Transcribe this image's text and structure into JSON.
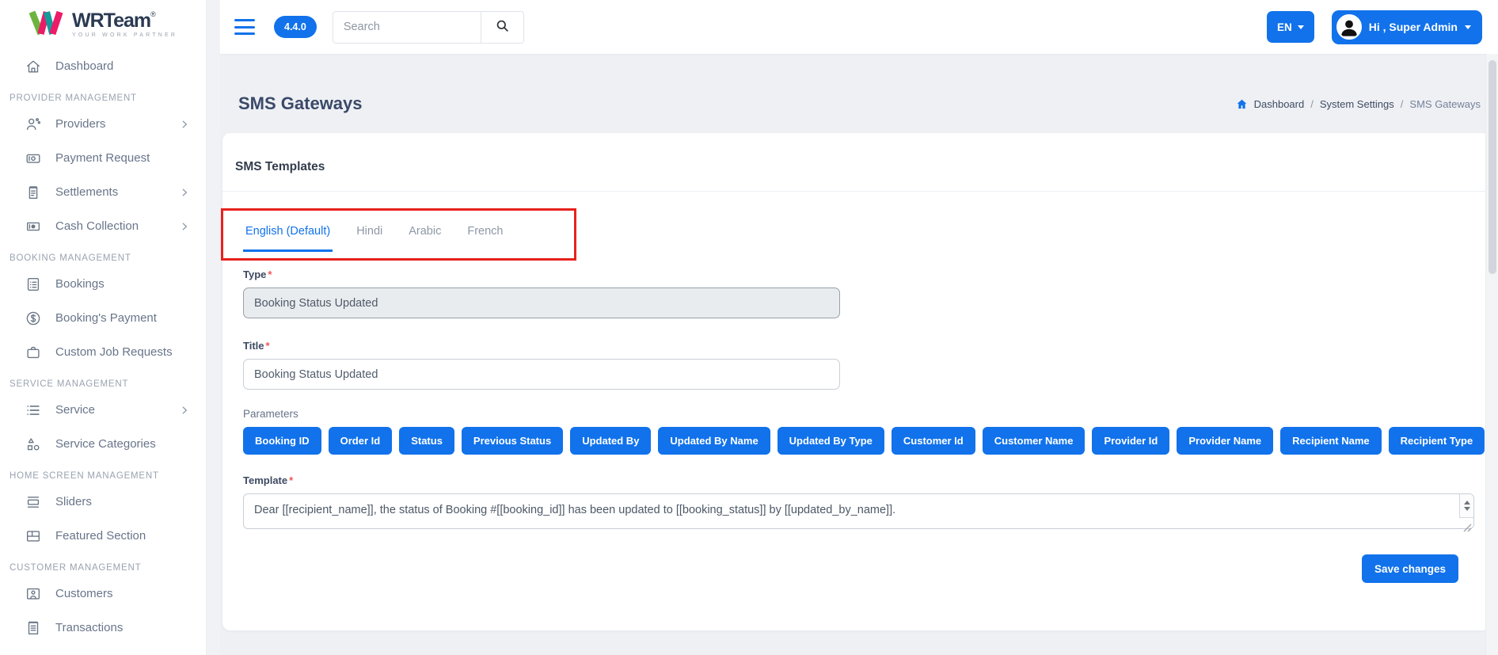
{
  "colors": {
    "primary": "#1172EB",
    "annotation": "#E8211D",
    "title_navy": "#3A4968",
    "brand_green": "#6CB33F",
    "brand_pink": "#EC1B68",
    "brand_teal": "#159A9C"
  },
  "brand": {
    "name": "WRTeam",
    "registered": "®",
    "tagline": "YOUR WORK PARTNER"
  },
  "topbar": {
    "version_badge": "4.4.0",
    "search_placeholder": "Search",
    "language": "EN",
    "user_greeting": "Hi , Super Admin"
  },
  "sidebar": {
    "entries": [
      {
        "type": "item",
        "icon": "home",
        "label": "Dashboard",
        "chevron": false
      },
      {
        "type": "section",
        "label": "PROVIDER MANAGEMENT"
      },
      {
        "type": "item",
        "icon": "providers",
        "label": "Providers",
        "chevron": true
      },
      {
        "type": "item",
        "icon": "payment-request",
        "label": "Payment Request",
        "chevron": false
      },
      {
        "type": "item",
        "icon": "settlements",
        "label": "Settlements",
        "chevron": true
      },
      {
        "type": "item",
        "icon": "cash-collection",
        "label": "Cash Collection",
        "chevron": true
      },
      {
        "type": "section",
        "label": "BOOKING MANAGEMENT"
      },
      {
        "type": "item",
        "icon": "bookings",
        "label": "Bookings",
        "chevron": false
      },
      {
        "type": "item",
        "icon": "bookings-payment",
        "label": "Booking's Payment",
        "chevron": false
      },
      {
        "type": "item",
        "icon": "custom-job-requests",
        "label": "Custom Job Requests",
        "chevron": false
      },
      {
        "type": "section",
        "label": "SERVICE MANAGEMENT"
      },
      {
        "type": "item",
        "icon": "service",
        "label": "Service",
        "chevron": true
      },
      {
        "type": "item",
        "icon": "service-categories",
        "label": "Service Categories",
        "chevron": false
      },
      {
        "type": "section",
        "label": "HOME SCREEN MANAGEMENT"
      },
      {
        "type": "item",
        "icon": "sliders",
        "label": "Sliders",
        "chevron": false
      },
      {
        "type": "item",
        "icon": "featured-section",
        "label": "Featured Section",
        "chevron": false
      },
      {
        "type": "section",
        "label": "CUSTOMER MANAGEMENT"
      },
      {
        "type": "item",
        "icon": "customers",
        "label": "Customers",
        "chevron": false
      },
      {
        "type": "item",
        "icon": "transactions",
        "label": "Transactions",
        "chevron": false
      }
    ]
  },
  "page": {
    "title": "SMS Gateways",
    "breadcrumb": [
      "Dashboard",
      "System Settings",
      "SMS Gateways"
    ]
  },
  "card": {
    "header": "SMS Templates",
    "tabs": [
      {
        "label": "English (Default)",
        "active": true
      },
      {
        "label": "Hindi",
        "active": false
      },
      {
        "label": "Arabic",
        "active": false
      },
      {
        "label": "French",
        "active": false
      }
    ],
    "form": {
      "type": {
        "label": "Type",
        "required": "*",
        "value": "Booking Status Updated"
      },
      "title": {
        "label": "Title",
        "required": "*",
        "value": "Booking Status Updated"
      },
      "parameters": {
        "label": "Parameters",
        "buttons": [
          "Booking ID",
          "Order Id",
          "Status",
          "Previous Status",
          "Updated By",
          "Updated By Name",
          "Updated By Type",
          "Customer Id",
          "Customer Name",
          "Provider Id",
          "Provider Name",
          "Recipient Name",
          "Recipient Type"
        ]
      },
      "template": {
        "label": "Template",
        "required": "*",
        "value": "Dear [[recipient_name]], the status of Booking #[[booking_id]] has been updated to [[booking_status]] by [[updated_by_name]]."
      }
    },
    "save_label": "Save changes"
  }
}
